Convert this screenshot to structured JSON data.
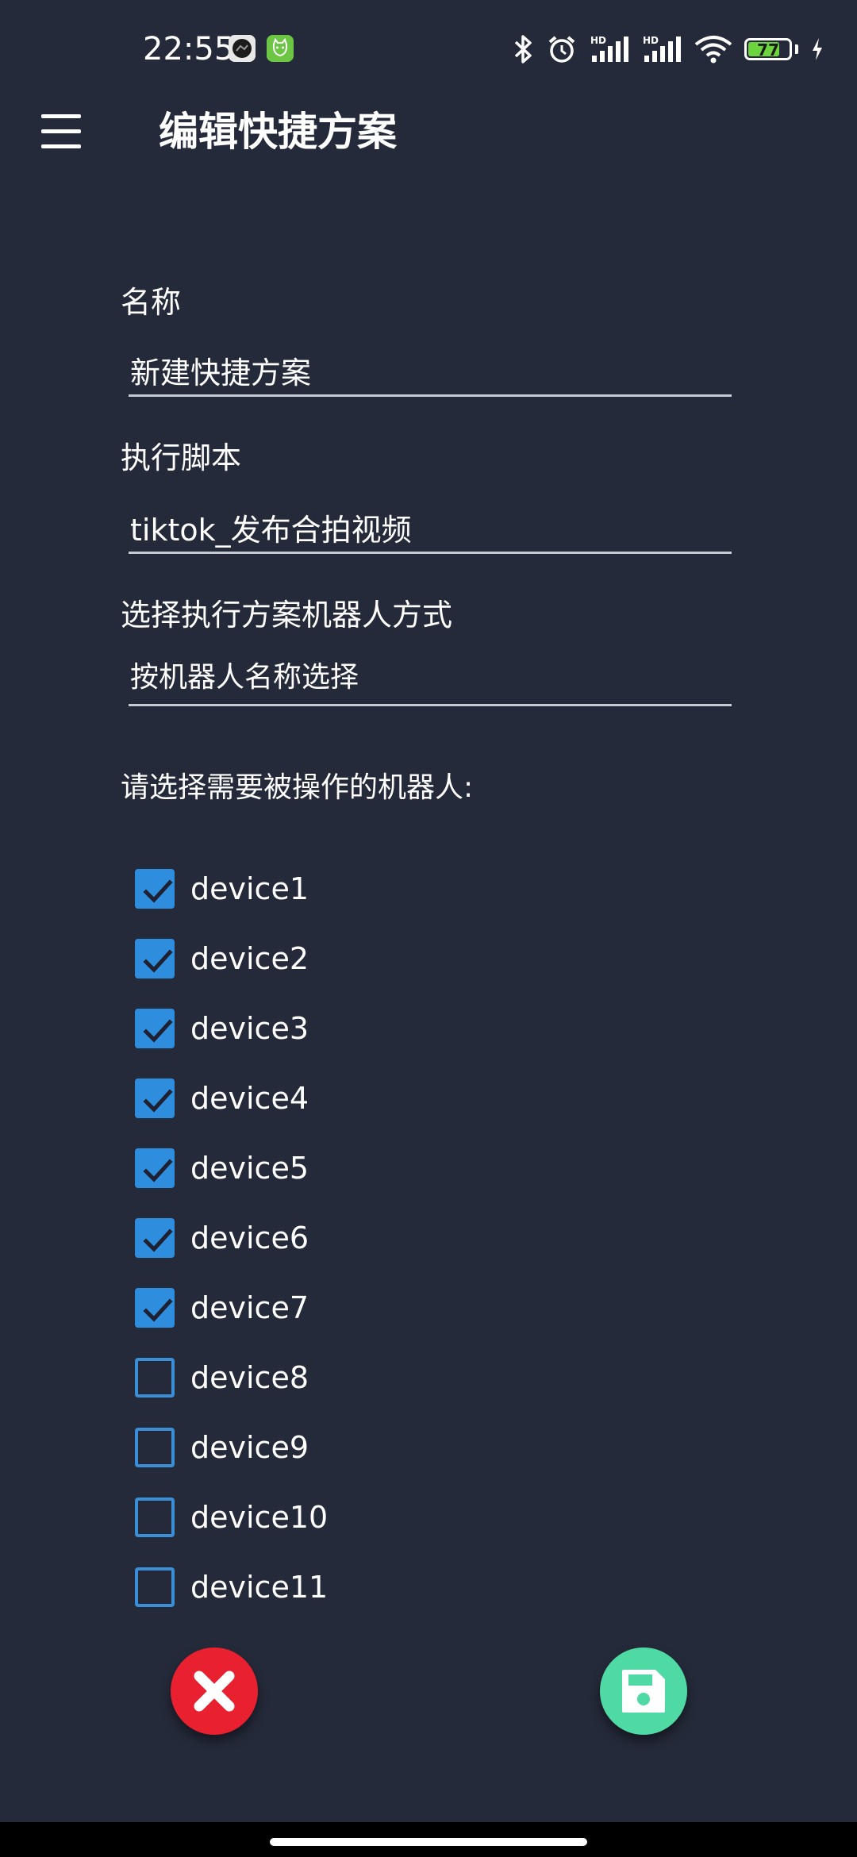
{
  "status_bar": {
    "time": "22:55",
    "battery_level": "77",
    "battery_fraction": 0.77,
    "icons": [
      "camera-app-icon",
      "cat-app-icon",
      "bluetooth-icon",
      "alarm-icon",
      "signal-hd-icon",
      "signal-hd-icon",
      "wifi-icon",
      "battery-icon",
      "charging-icon"
    ]
  },
  "app_bar": {
    "title": "编辑快捷方案",
    "menu_icon": "hamburger-menu-icon"
  },
  "form": {
    "name_label": "名称",
    "name_value": "新建快捷方案",
    "script_label": "执行脚本",
    "script_value": "tiktok_发布合拍视频",
    "mode_label": "选择执行方案机器人方式",
    "mode_value": "按机器人名称选择"
  },
  "devices": {
    "title": "请选择需要被操作的机器人:",
    "items": [
      {
        "label": "device1",
        "checked": true
      },
      {
        "label": "device2",
        "checked": true
      },
      {
        "label": "device3",
        "checked": true
      },
      {
        "label": "device4",
        "checked": true
      },
      {
        "label": "device5",
        "checked": true
      },
      {
        "label": "device6",
        "checked": true
      },
      {
        "label": "device7",
        "checked": true
      },
      {
        "label": "device8",
        "checked": false
      },
      {
        "label": "device9",
        "checked": false
      },
      {
        "label": "device10",
        "checked": false
      },
      {
        "label": "device11",
        "checked": false
      }
    ]
  },
  "actions": {
    "cancel_icon": "close-x-icon",
    "save_icon": "floppy-save-icon"
  },
  "colors": {
    "background": "#252a3a",
    "checkbox_accent": "#2f8ddd",
    "cancel": "#e8202f",
    "save": "#4fd9a4",
    "battery": "#6cd43c"
  }
}
